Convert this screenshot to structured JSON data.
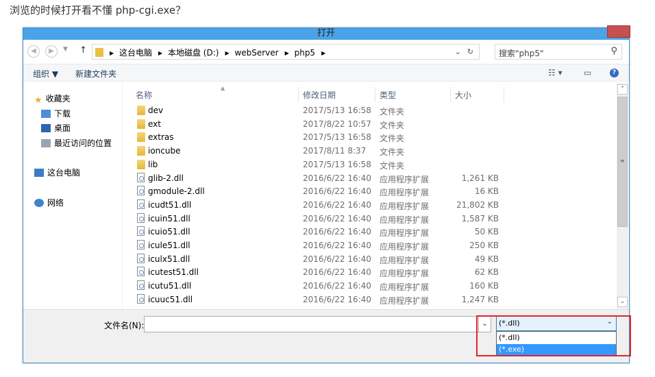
{
  "question": "浏览的时候打开看不懂 php-cgi.exe？",
  "dialog": {
    "title": "打开"
  },
  "address": {
    "crumbs": [
      "这台电脑",
      "本地磁盘 (D:)",
      "webServer",
      "php5"
    ],
    "search_placeholder": "搜索\"php5\""
  },
  "toolbar": {
    "organize": "组织 ▼",
    "new_folder": "新建文件夹"
  },
  "nav": {
    "favorites": "收藏夹",
    "downloads": "下载",
    "desktop": "桌面",
    "recent": "最近访问的位置",
    "this_pc": "这台电脑",
    "network": "网络"
  },
  "columns": {
    "name": "名称",
    "date": "修改日期",
    "type": "类型",
    "size": "大小"
  },
  "files": [
    {
      "name": "dev",
      "date": "2017/5/13 16:58",
      "type": "文件夹",
      "size": "",
      "kind": "folder"
    },
    {
      "name": "ext",
      "date": "2017/8/22 10:57",
      "type": "文件夹",
      "size": "",
      "kind": "folder"
    },
    {
      "name": "extras",
      "date": "2017/5/13 16:58",
      "type": "文件夹",
      "size": "",
      "kind": "folder"
    },
    {
      "name": "ioncube",
      "date": "2017/8/11 8:37",
      "type": "文件夹",
      "size": "",
      "kind": "folder"
    },
    {
      "name": "lib",
      "date": "2017/5/13 16:58",
      "type": "文件夹",
      "size": "",
      "kind": "folder"
    },
    {
      "name": "glib-2.dll",
      "date": "2016/6/22 16:40",
      "type": "应用程序扩展",
      "size": "1,261 KB",
      "kind": "dll"
    },
    {
      "name": "gmodule-2.dll",
      "date": "2016/6/22 16:40",
      "type": "应用程序扩展",
      "size": "16 KB",
      "kind": "dll"
    },
    {
      "name": "icudt51.dll",
      "date": "2016/6/22 16:40",
      "type": "应用程序扩展",
      "size": "21,802 KB",
      "kind": "dll"
    },
    {
      "name": "icuin51.dll",
      "date": "2016/6/22 16:40",
      "type": "应用程序扩展",
      "size": "1,587 KB",
      "kind": "dll"
    },
    {
      "name": "icuio51.dll",
      "date": "2016/6/22 16:40",
      "type": "应用程序扩展",
      "size": "50 KB",
      "kind": "dll"
    },
    {
      "name": "icule51.dll",
      "date": "2016/6/22 16:40",
      "type": "应用程序扩展",
      "size": "250 KB",
      "kind": "dll"
    },
    {
      "name": "iculx51.dll",
      "date": "2016/6/22 16:40",
      "type": "应用程序扩展",
      "size": "49 KB",
      "kind": "dll"
    },
    {
      "name": "icutest51.dll",
      "date": "2016/6/22 16:40",
      "type": "应用程序扩展",
      "size": "62 KB",
      "kind": "dll"
    },
    {
      "name": "icutu51.dll",
      "date": "2016/6/22 16:40",
      "type": "应用程序扩展",
      "size": "160 KB",
      "kind": "dll"
    },
    {
      "name": "icuuc51.dll",
      "date": "2016/6/22 16:40",
      "type": "应用程序扩展",
      "size": "1,247 KB",
      "kind": "dll"
    }
  ],
  "bottom": {
    "filename_label": "文件名(N):",
    "filename_value": "",
    "filetype_selected": "(*.dll)",
    "filetype_options": [
      "(*.dll)",
      "(*.exe)"
    ],
    "filetype_highlighted": "(*.exe)"
  },
  "colors": {
    "titlebar": "#4aa3e6",
    "close": "#c75050",
    "highlight_box": "#e0252c",
    "selection": "#3399ff"
  }
}
